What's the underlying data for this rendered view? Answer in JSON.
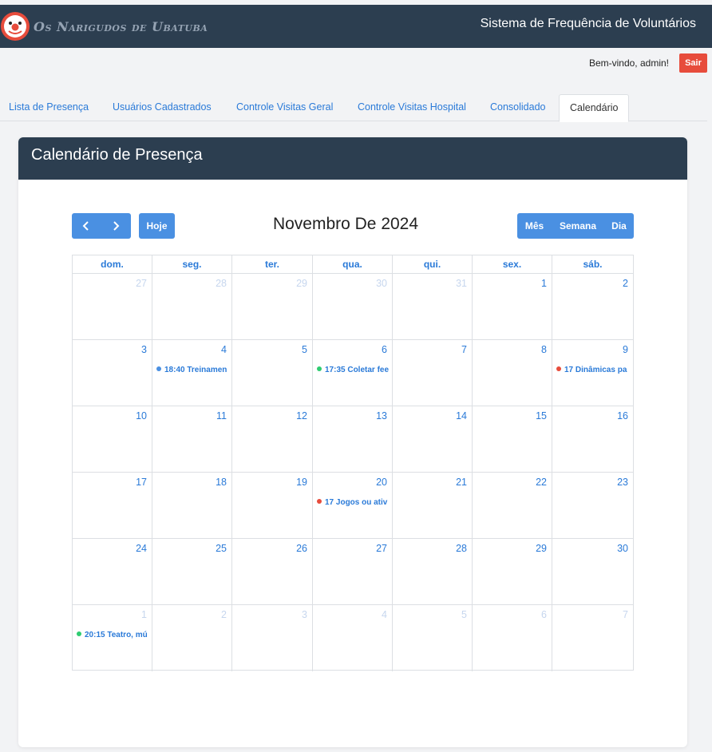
{
  "app": {
    "brand": "Os Narigudos de Ubatuba",
    "system_title": "Sistema de Frequência de Voluntários",
    "welcome": "Bem-vindo, admin!",
    "logout_label": "Sair"
  },
  "tabs": [
    {
      "label": "Lista de Presença"
    },
    {
      "label": "Usuários Cadastrados"
    },
    {
      "label": "Controle Visitas Geral"
    },
    {
      "label": "Controle Visitas Hospital"
    },
    {
      "label": "Consolidado"
    },
    {
      "label": "Calendário",
      "active": true
    }
  ],
  "calendar": {
    "card_title": "Calendário de Presença",
    "today_label": "Hoje",
    "month_title": "Novembro De 2024",
    "views": [
      "Mês",
      "Semana",
      "Dia"
    ],
    "day_headers": [
      "dom.",
      "seg.",
      "ter.",
      "qua.",
      "qui.",
      "sex.",
      "sáb."
    ],
    "weeks": [
      [
        {
          "d": "27",
          "other": true
        },
        {
          "d": "28",
          "other": true
        },
        {
          "d": "29",
          "other": true
        },
        {
          "d": "30",
          "other": true
        },
        {
          "d": "31",
          "other": true
        },
        {
          "d": "1"
        },
        {
          "d": "2"
        }
      ],
      [
        {
          "d": "3"
        },
        {
          "d": "4",
          "event": "18:40 Treinamen",
          "color": "#4a90e2"
        },
        {
          "d": "5"
        },
        {
          "d": "6",
          "event": "17:35 Coletar fee",
          "color": "#2ecc71"
        },
        {
          "d": "7"
        },
        {
          "d": "8"
        },
        {
          "d": "9",
          "event": "17 Dinâmicas pa",
          "color": "#e74c3c"
        }
      ],
      [
        {
          "d": "10"
        },
        {
          "d": "11"
        },
        {
          "d": "12"
        },
        {
          "d": "13"
        },
        {
          "d": "14"
        },
        {
          "d": "15"
        },
        {
          "d": "16"
        }
      ],
      [
        {
          "d": "17"
        },
        {
          "d": "18"
        },
        {
          "d": "19"
        },
        {
          "d": "20",
          "event": "17 Jogos ou ativ",
          "color": "#e74c3c"
        },
        {
          "d": "21"
        },
        {
          "d": "22"
        },
        {
          "d": "23"
        }
      ],
      [
        {
          "d": "24"
        },
        {
          "d": "25"
        },
        {
          "d": "26"
        },
        {
          "d": "27"
        },
        {
          "d": "28"
        },
        {
          "d": "29"
        },
        {
          "d": "30"
        }
      ],
      [
        {
          "d": "1",
          "other": true,
          "event": "20:15 Teatro, mú",
          "color": "#2ecc71"
        },
        {
          "d": "2",
          "other": true
        },
        {
          "d": "3",
          "other": true
        },
        {
          "d": "4",
          "other": true
        },
        {
          "d": "5",
          "other": true
        },
        {
          "d": "6",
          "other": true
        },
        {
          "d": "7",
          "other": true
        }
      ]
    ]
  },
  "icons": {
    "logo": "clown-face-icon",
    "prev": "chevron-left-icon",
    "next": "chevron-right-icon"
  },
  "colors": {
    "header_bg": "#2c3e50",
    "accent": "#4a90e2",
    "logout": "#e74c3c"
  }
}
